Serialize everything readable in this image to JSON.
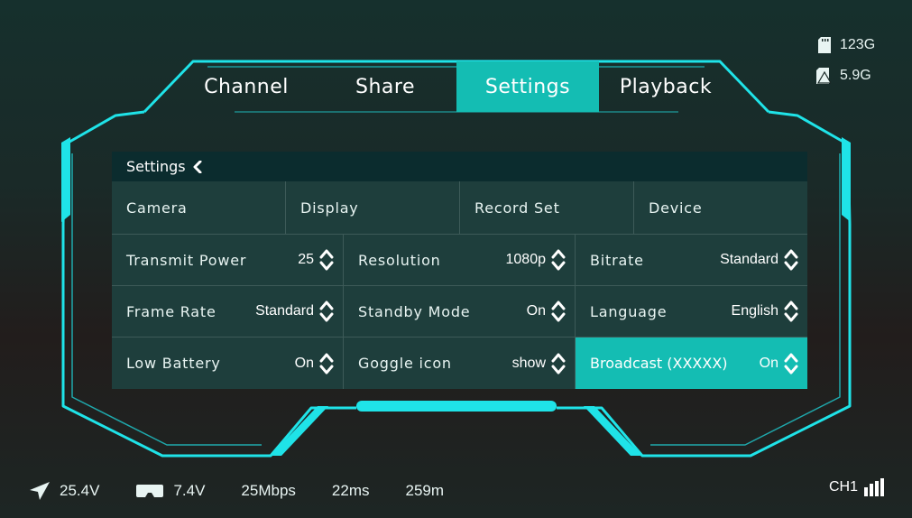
{
  "tabs": [
    {
      "label": "Channel",
      "active": false
    },
    {
      "label": "Share",
      "active": false
    },
    {
      "label": "Settings",
      "active": true
    },
    {
      "label": "Playback",
      "active": false
    }
  ],
  "storage": {
    "sd_card": "123G",
    "internal": "5.9G"
  },
  "panel": {
    "title": "Settings",
    "subtabs": [
      "Camera",
      "Display",
      "Record Set",
      "Device"
    ],
    "cells": [
      {
        "label": "Transmit Power",
        "value": "25"
      },
      {
        "label": "Resolution",
        "value": "1080p"
      },
      {
        "label": "Bitrate",
        "value": "Standard"
      },
      {
        "label": "Frame Rate",
        "value": "Standard"
      },
      {
        "label": "Standby Mode",
        "value": "On"
      },
      {
        "label": "Language",
        "value": "English"
      },
      {
        "label": "Low Battery",
        "value": "On"
      },
      {
        "label": "Goggle icon",
        "value": "show"
      },
      {
        "label": "Broadcast (XXXXX)",
        "value": "On",
        "active": true
      }
    ]
  },
  "status": {
    "drone_voltage": "25.4V",
    "goggle_voltage": "7.4V",
    "bitrate": "25Mbps",
    "latency": "22ms",
    "distance": "259m",
    "channel": "CH1"
  },
  "colors": {
    "accent": "#14bdb3",
    "frame": "#1fe3e8",
    "panel": "#1e3e3c",
    "panel_header": "#0b2c2e"
  },
  "icons": [
    "sd-card-icon",
    "storage-icon",
    "back-chevron-icon",
    "stepper-icon",
    "aircraft-icon",
    "goggles-icon",
    "signal-bars-icon"
  ]
}
